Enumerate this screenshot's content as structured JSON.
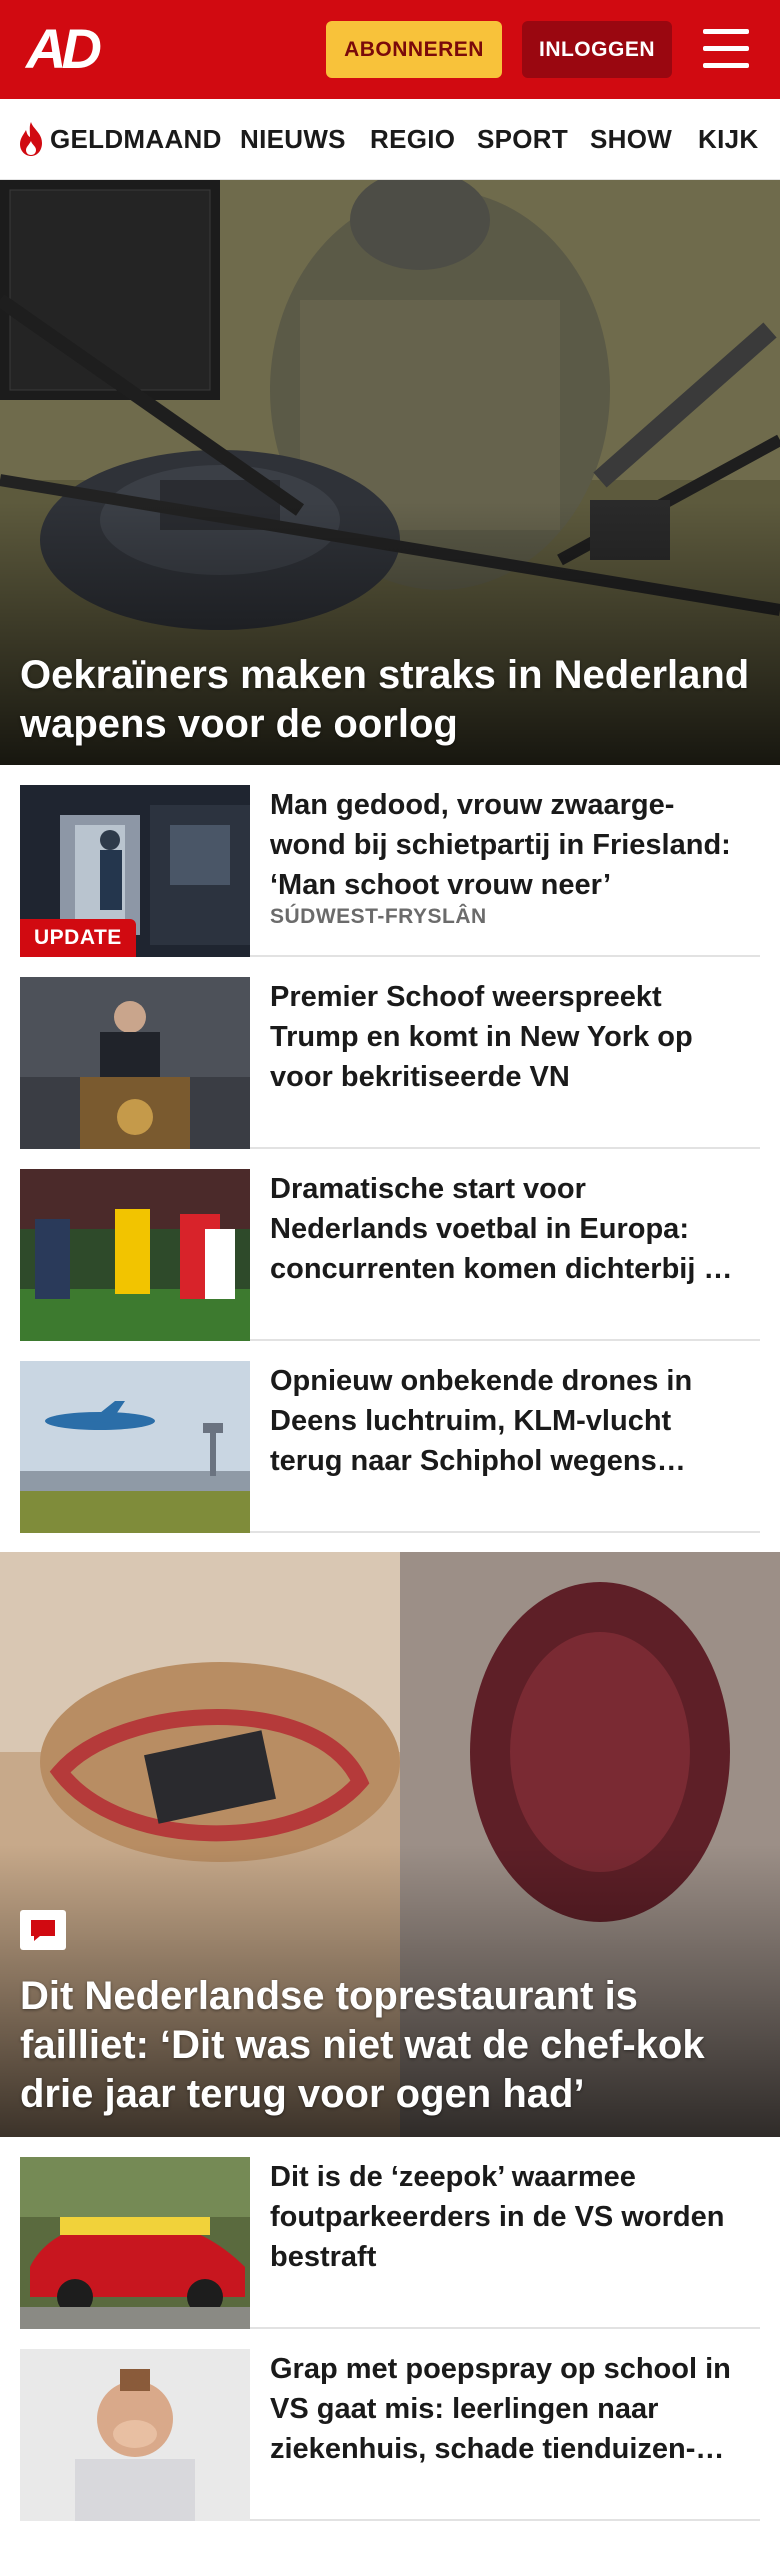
{
  "header": {
    "logo": "AD",
    "subscribe_label": "ABONNEREN",
    "login_label": "INLOGGEN",
    "menu_icon": "hamburger-menu-icon"
  },
  "nav": {
    "items": [
      {
        "label": "GELDMAAND",
        "icon": "flame-icon"
      },
      {
        "label": "NIEUWS"
      },
      {
        "label": "REGIO"
      },
      {
        "label": "SPORT"
      },
      {
        "label": "SHOW"
      },
      {
        "label": "KIJK"
      }
    ]
  },
  "hero": {
    "title": "Oekraïners maken straks in Nederland wapens voor de oorlog"
  },
  "articles": [
    {
      "title": "Man gedood, vrouw zwaarge-wond bij schietpartij in Friesland: ‘Man schoot vrouw neer’",
      "region": "SÚDWEST-FRYSLÂN",
      "badge": "UPDATE"
    },
    {
      "title": "Premier Schoof weerspreekt Trump en komt in New York op voor bekritiseerde VN"
    },
    {
      "title": "Dramatische start voor Nederlands voetbal in Europa: concurrenten komen dichterbij …"
    },
    {
      "title": "Opnieuw onbekende drones in Deens luchtruim, KLM-vlucht terug naar Schiphol wegens…"
    }
  ],
  "feature": {
    "title": "Dit Nederlandse toprestaurant is failliet: ‘Dit was niet wat de chef-kok drie jaar terug voor ogen had’",
    "icon": "comment-icon"
  },
  "articles_bottom": [
    {
      "title": "Dit is de ‘zeepok’ waarmee foutparkeerders in de VS worden bestraft"
    },
    {
      "title": "Grap met poepspray op school in VS gaat mis: leerlingen naar ziekenhuis, schade tienduizen-…"
    }
  ],
  "colors": {
    "brand_red": "#d10a11",
    "subscribe_yellow": "#f8c23a",
    "login_dark_red": "#9a0710"
  }
}
